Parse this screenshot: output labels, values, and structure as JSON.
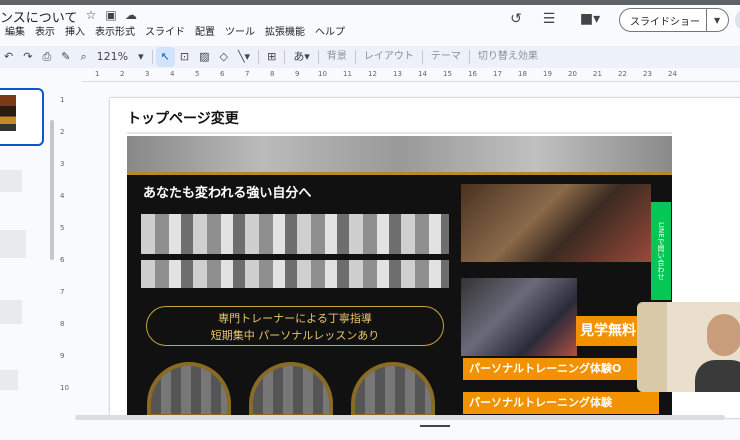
{
  "app": {
    "doc_title": "ンスについて",
    "menus": [
      "編集",
      "表示",
      "挿入",
      "表示形式",
      "スライド",
      "配置",
      "ツール",
      "拡張機能",
      "ヘルプ"
    ],
    "slideshow_label": "スライドショー"
  },
  "toolbar": {
    "zoom": "121%",
    "text_buttons": [
      "背景",
      "レイアウト",
      "テーマ",
      "切り替え効果"
    ]
  },
  "ruler": {
    "top": [
      "1",
      "2",
      "3",
      "4",
      "5",
      "6",
      "7",
      "8",
      "9",
      "10",
      "11",
      "12",
      "13",
      "14",
      "15",
      "16",
      "17",
      "18",
      "19",
      "20",
      "21",
      "22",
      "23",
      "24"
    ],
    "left": [
      "1",
      "2",
      "3",
      "4",
      "5",
      "6",
      "7",
      "8",
      "9",
      "10"
    ]
  },
  "slide": {
    "title": "トップページ変更",
    "hero_title": "あなたも変われる強い自分へ",
    "pill_line1": "専門トレーナーによる丁寧指導",
    "pill_line2": "短期集中 パーソナルレッスンあり",
    "line_tab": "LINEで問い合わせ",
    "kengaku": "見学無料",
    "cta1": "パーソナルトレーニング体験O",
    "cta2": "パーソナルトレーニング体験"
  },
  "colors": {
    "accent": "#0b57d0",
    "cta": "#f39200",
    "line_green": "#06c755",
    "gold": "#c9a43c"
  }
}
